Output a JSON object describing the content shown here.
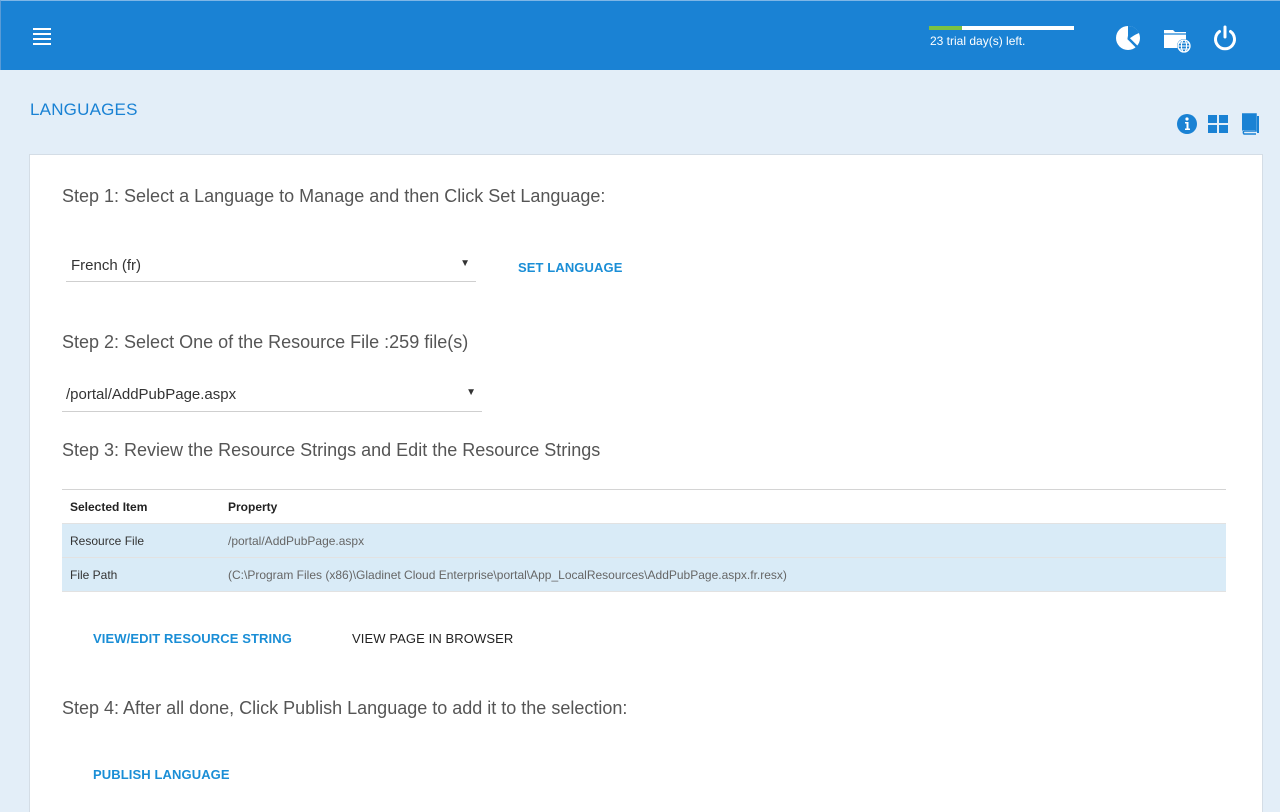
{
  "header": {
    "trial_text": "23 trial day(s) left.",
    "trial_progress": 0.23,
    "icons": [
      "dashboard-pie-icon",
      "folder-globe-icon",
      "power-icon"
    ]
  },
  "page": {
    "title": "LANGUAGES",
    "tools": [
      "info-icon",
      "grid-view-icon",
      "book-icon"
    ]
  },
  "step1": {
    "label": "Step 1: Select a Language to Manage and then Click Set Language:",
    "language_value": "French (fr)",
    "set_button": "SET LANGUAGE"
  },
  "step2": {
    "label": "Step 2: Select One of the Resource File :259 file(s)",
    "file_value": "/portal/AddPubPage.aspx"
  },
  "step3": {
    "label": "Step 3: Review the Resource Strings and Edit the Resource Strings",
    "table": {
      "headers": [
        "Selected Item",
        "Property"
      ],
      "rows": [
        [
          "Resource File",
          "/portal/AddPubPage.aspx"
        ],
        [
          "File Path",
          "(C:\\Program Files (x86)\\Gladinet Cloud Enterprise\\portal\\App_LocalResources\\AddPubPage.aspx.fr.resx)"
        ]
      ]
    },
    "view_edit_button": "VIEW/EDIT RESOURCE STRING",
    "view_page_button": "VIEW PAGE IN BROWSER"
  },
  "step4": {
    "label": "Step 4: After all done, Click Publish Language to add it to the selection:",
    "publish_button": "PUBLISH LANGUAGE"
  },
  "colors": {
    "topbar": "#1a82d4",
    "accent": "#1a8ed6",
    "row_highlight": "#d9ebf7",
    "trial_fill": "#7ac143"
  }
}
